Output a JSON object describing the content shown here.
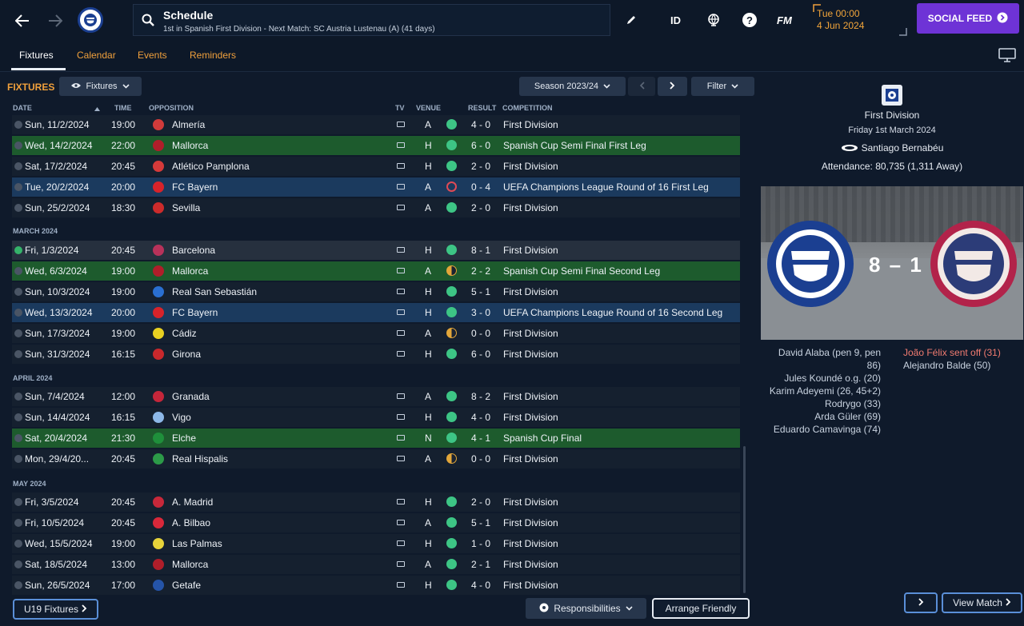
{
  "header": {
    "title": "Schedule",
    "subtitle": "1st in Spanish First Division - Next Match: SC Austria Lustenau (A) (41 days)",
    "id_label": "ID",
    "fm_label": "FM",
    "time": "Tue 00:00",
    "date": "4 Jun 2024",
    "social_feed": "SOCIAL FEED"
  },
  "tabs": [
    "Fixtures",
    "Calendar",
    "Events",
    "Reminders"
  ],
  "toolbar": {
    "section_label": "FIXTURES",
    "view_dropdown": "Fixtures",
    "season": "Season 2023/24",
    "filter": "Filter"
  },
  "columns": {
    "date": "DATE",
    "time": "TIME",
    "opposition": "OPPOSITION",
    "tv": "TV",
    "venue": "VENUE",
    "result": "RESULT",
    "competition": "COMPETITION"
  },
  "months": [
    "MARCH 2024",
    "APRIL 2024",
    "MAY 2024"
  ],
  "fixtures": [
    {
      "date": "Sun, 11/2/2024",
      "time": "19:00",
      "opp": "Almería",
      "venue": "A",
      "res": "w",
      "score": "4 - 0",
      "comp": "First Division",
      "style": "dark",
      "crest": "#d13b3b"
    },
    {
      "date": "Wed, 14/2/2024",
      "time": "22:00",
      "opp": "Mallorca",
      "venue": "H",
      "res": "w",
      "score": "6 - 0",
      "comp": "Spanish Cup Semi Final First Leg",
      "style": "green",
      "crest": "#b01e2a"
    },
    {
      "date": "Sat, 17/2/2024",
      "time": "20:45",
      "opp": "Atlético Pamplona",
      "venue": "H",
      "res": "w",
      "score": "2 - 0",
      "comp": "First Division",
      "style": "dark",
      "crest": "#d53a3a"
    },
    {
      "date": "Tue, 20/2/2024",
      "time": "20:00",
      "opp": "FC Bayern",
      "venue": "A",
      "res": "l",
      "score": "0 - 4",
      "comp": "UEFA Champions League Round of 16  First Leg",
      "style": "blue",
      "crest": "#d8232a"
    },
    {
      "date": "Sun, 25/2/2024",
      "time": "18:30",
      "opp": "Sevilla",
      "venue": "A",
      "res": "w",
      "score": "2 - 0",
      "comp": "First Division",
      "style": "dark",
      "crest": "#cc2b2b"
    },
    {
      "date": "Fri, 1/3/2024",
      "time": "20:45",
      "opp": "Barcelona",
      "venue": "H",
      "res": "w",
      "score": "8 - 1",
      "comp": "First Division",
      "style": "sel",
      "crest": "#b8325a"
    },
    {
      "date": "Wed, 6/3/2024",
      "time": "19:00",
      "opp": "Mallorca",
      "venue": "A",
      "res": "d",
      "score": "2 - 2",
      "comp": "Spanish Cup Semi Final Second Leg",
      "style": "green",
      "crest": "#b01e2a"
    },
    {
      "date": "Sun, 10/3/2024",
      "time": "19:00",
      "opp": "Real San Sebastián",
      "venue": "H",
      "res": "w",
      "score": "5 - 1",
      "comp": "First Division",
      "style": "dark",
      "crest": "#2a6fd1"
    },
    {
      "date": "Wed, 13/3/2024",
      "time": "20:00",
      "opp": "FC Bayern",
      "venue": "H",
      "res": "w",
      "score": "3 - 0",
      "comp": "UEFA Champions League Round of 16  Second Leg",
      "style": "blue",
      "crest": "#d8232a"
    },
    {
      "date": "Sun, 17/3/2024",
      "time": "19:00",
      "opp": "Cádiz",
      "venue": "A",
      "res": "d",
      "score": "0 - 0",
      "comp": "First Division",
      "style": "dark",
      "crest": "#e8d021"
    },
    {
      "date": "Sun, 31/3/2024",
      "time": "16:15",
      "opp": "Girona",
      "venue": "H",
      "res": "w",
      "score": "6 - 0",
      "comp": "First Division",
      "style": "dark",
      "crest": "#c8282c"
    },
    {
      "date": "Sun, 7/4/2024",
      "time": "12:00",
      "opp": "Granada",
      "venue": "A",
      "res": "w",
      "score": "8 - 2",
      "comp": "First Division",
      "style": "dark",
      "crest": "#c4263a"
    },
    {
      "date": "Sun, 14/4/2024",
      "time": "16:15",
      "opp": "Vigo",
      "venue": "H",
      "res": "w",
      "score": "4 - 0",
      "comp": "First Division",
      "style": "dark",
      "crest": "#8db8e8"
    },
    {
      "date": "Sat, 20/4/2024",
      "time": "21:30",
      "opp": "Elche",
      "venue": "N",
      "res": "w",
      "score": "4 - 1",
      "comp": "Spanish Cup Final",
      "style": "green",
      "crest": "#1f8f3b"
    },
    {
      "date": "Mon, 29/4/20...",
      "time": "20:45",
      "opp": "Real Hispalis",
      "venue": "A",
      "res": "d",
      "score": "0 - 0",
      "comp": "First Division",
      "style": "dark",
      "crest": "#2c9a48"
    },
    {
      "date": "Fri, 3/5/2024",
      "time": "20:45",
      "opp": "A. Madrid",
      "venue": "H",
      "res": "w",
      "score": "2 - 0",
      "comp": "First Division",
      "style": "dark",
      "crest": "#c8283a"
    },
    {
      "date": "Fri, 10/5/2024",
      "time": "20:45",
      "opp": "A. Bilbao",
      "venue": "A",
      "res": "w",
      "score": "5 - 1",
      "comp": "First Division",
      "style": "dark",
      "crest": "#d9283a"
    },
    {
      "date": "Wed, 15/5/2024",
      "time": "19:00",
      "opp": "Las Palmas",
      "venue": "H",
      "res": "w",
      "score": "1 - 0",
      "comp": "First Division",
      "style": "dark",
      "crest": "#e7d33a"
    },
    {
      "date": "Sat, 18/5/2024",
      "time": "13:00",
      "opp": "Mallorca",
      "venue": "A",
      "res": "w",
      "score": "2 - 1",
      "comp": "First Division",
      "style": "dark",
      "crest": "#b01e2a"
    },
    {
      "date": "Sun, 26/5/2024",
      "time": "17:00",
      "opp": "Getafe",
      "venue": "H",
      "res": "w",
      "score": "4 - 0",
      "comp": "First Division",
      "style": "dark",
      "crest": "#2554a8"
    }
  ],
  "footer": {
    "u19": "U19 Fixtures",
    "responsibilities": "Responsibilities",
    "arrange": "Arrange Friendly",
    "view_match": "View Match"
  },
  "match": {
    "competition": "First Division",
    "date": "Friday 1st March 2024",
    "stadium": "Santiago Bernabéu",
    "attendance": "Attendance: 80,735 (1,311 Away)",
    "score": "8 – 1",
    "home_scorers": [
      "David Alaba (pen 9, pen",
      "86)",
      "Jules Koundé o.g. (20)",
      "Karim Adeyemi (26, 45+2)",
      "Rodrygo (33)",
      "Arda Güler (69)",
      "Eduardo Camavinga (74)"
    ],
    "away_events": [
      "João Félix sent off (31)",
      "Alejandro Balde (50)"
    ]
  },
  "colors": {
    "accent_orange": "#f0a03c",
    "social_purple": "#6e33d6",
    "win": "#3dc585",
    "loss": "#e04a55",
    "draw": "#e2a63a",
    "sent_off": "#f07b70"
  }
}
